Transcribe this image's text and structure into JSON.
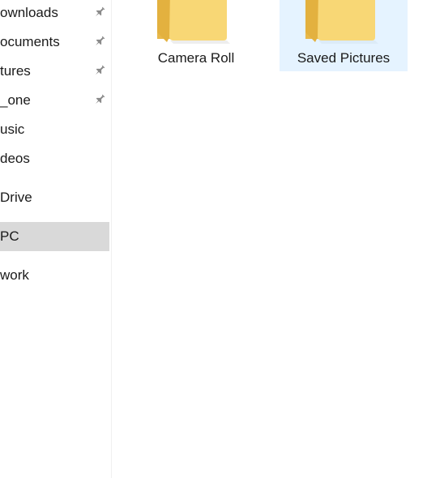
{
  "nav_pane": {
    "items": [
      {
        "label": "ownloads",
        "pinned": true
      },
      {
        "label": "ocuments",
        "pinned": true
      },
      {
        "label": "tures",
        "pinned": true
      },
      {
        "label": "_one",
        "pinned": true
      },
      {
        "label": "usic",
        "pinned": false
      },
      {
        "label": "deos",
        "pinned": false
      },
      {
        "label": " Drive",
        "pinned": false
      },
      {
        "label": " PC",
        "pinned": false,
        "selected": true
      },
      {
        "label": "work",
        "pinned": false
      }
    ],
    "pin_icon": "pin-icon",
    "selected_color": "#d9d9d9"
  },
  "content": {
    "folders": [
      {
        "label": "Camera Roll",
        "icon": "folder-icon",
        "selected": false
      },
      {
        "label": "Saved Pictures",
        "icon": "folder-icon",
        "selected": true
      }
    ],
    "selected_color": "#e5f3ff",
    "folder_color": "#f5d06a"
  }
}
